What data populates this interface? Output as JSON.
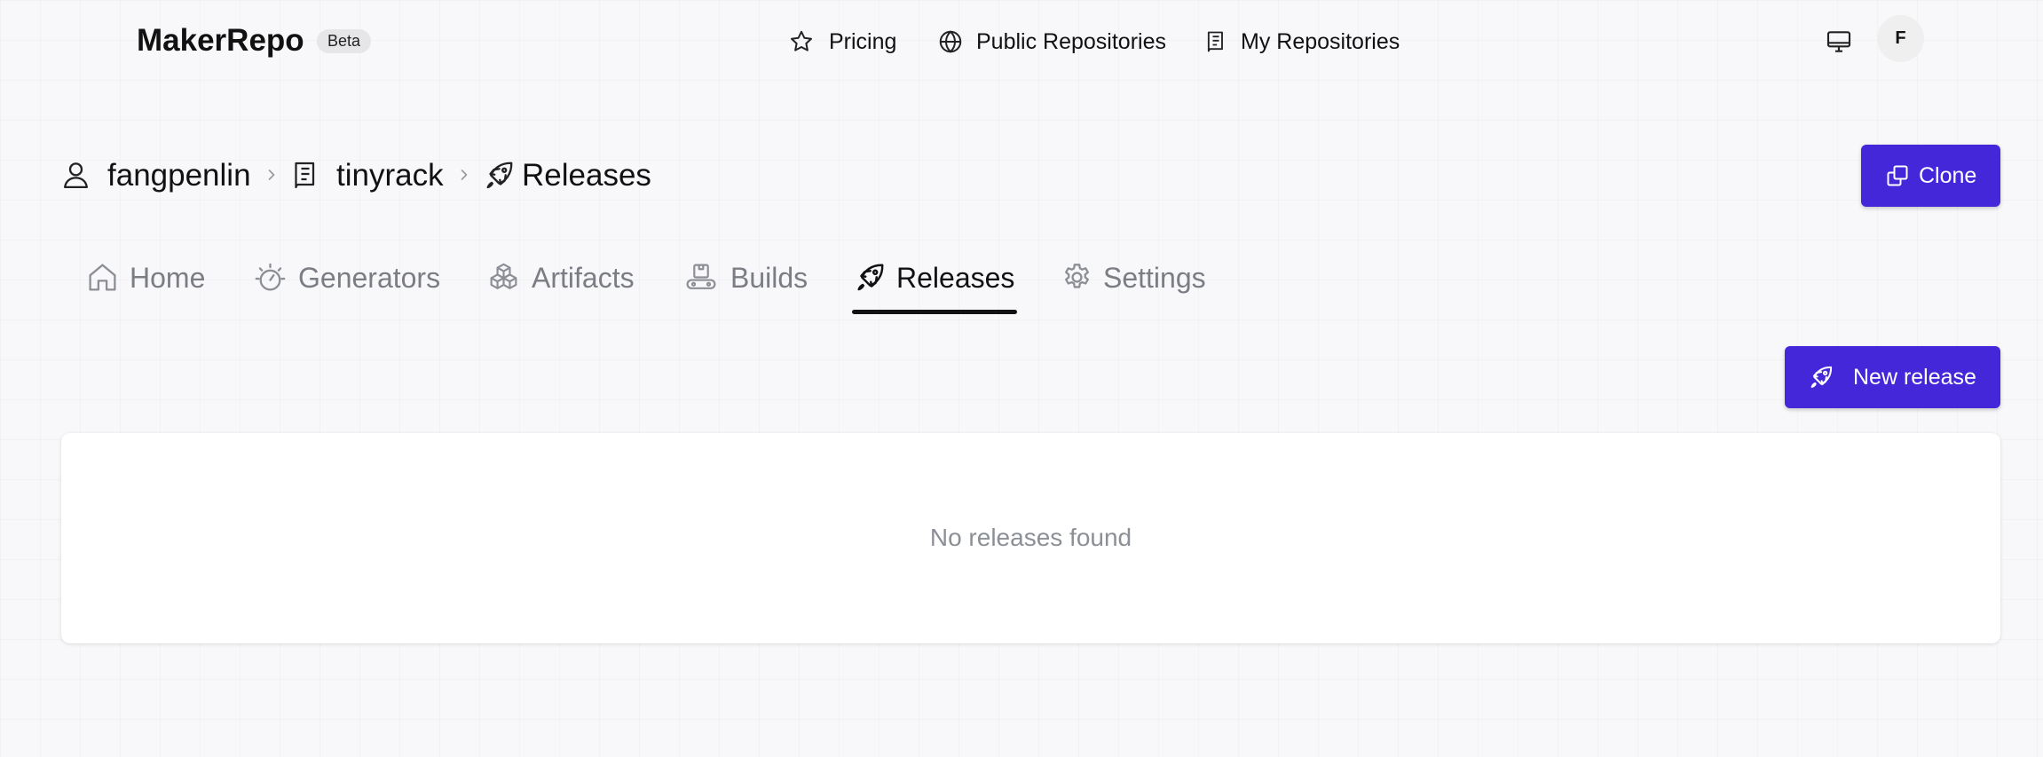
{
  "brand": {
    "name": "MakerRepo",
    "badge": "Beta"
  },
  "topnav": [
    {
      "label": "Pricing",
      "icon": "star-icon"
    },
    {
      "label": "Public Repositories",
      "icon": "globe-icon"
    },
    {
      "label": "My Repositories",
      "icon": "book-icon"
    }
  ],
  "header_actions": {
    "theme_icon": "monitor-icon",
    "avatar_initial": "F"
  },
  "breadcrumb": {
    "items": [
      {
        "label": "fangpenlin",
        "icon": "user-icon"
      },
      {
        "label": "tinyrack",
        "icon": "book-icon"
      },
      {
        "label": "Releases",
        "icon": "rocket-icon"
      }
    ],
    "separator_icon": "chevron-right-icon"
  },
  "clone_button": {
    "label": "Clone",
    "icon": "copy-icon"
  },
  "tabs": [
    {
      "label": "Home",
      "icon": "home-icon",
      "active": false
    },
    {
      "label": "Generators",
      "icon": "generator-icon",
      "active": false
    },
    {
      "label": "Artifacts",
      "icon": "boxes-icon",
      "active": false
    },
    {
      "label": "Builds",
      "icon": "conveyor-icon",
      "active": false
    },
    {
      "label": "Releases",
      "icon": "rocket-icon",
      "active": true
    },
    {
      "label": "Settings",
      "icon": "gear-icon",
      "active": false
    }
  ],
  "new_release_button": {
    "label": "New release",
    "icon": "rocket-icon"
  },
  "releases": {
    "items": [],
    "empty_message": "No releases found"
  },
  "colors": {
    "accent": "#4427d9",
    "muted_text": "#7a7d83",
    "badge_bg": "#e6e6e9",
    "tab_underline": "#111111"
  }
}
